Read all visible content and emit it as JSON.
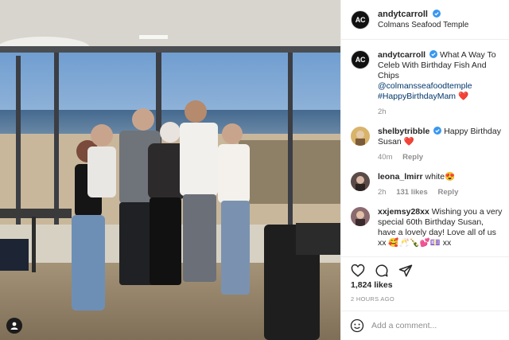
{
  "post": {
    "username": "andytcarroll",
    "location": "Colmans Seafood Temple",
    "avatar_text": "AC",
    "verified": true
  },
  "caption": {
    "username": "andytcarroll",
    "text": "What A Way To Celeb With Birthday Fish And Chips",
    "mention": "@colmansseafoodtemple",
    "hashtag": "#HappyBirthdayMam",
    "emoji": "❤️",
    "time": "2h"
  },
  "comments": [
    {
      "username": "shelbytribble",
      "verified": true,
      "text": "Happy Birthday Susan",
      "emoji": "❤️",
      "time": "40m",
      "likes": "",
      "reply": "Reply"
    },
    {
      "username": "leona_lmirr",
      "verified": false,
      "text": "white",
      "emoji": "😍",
      "time": "2h",
      "likes": "131 likes",
      "reply": "Reply"
    },
    {
      "username": "xxjemsy28xx",
      "verified": false,
      "text": "Wishing you a very special 60th Birthday Susan, have a lovely day! Love all of us xx",
      "emoji": "🥰🥂🍾💕💷 xx",
      "time": "",
      "likes": "",
      "reply": ""
    }
  ],
  "actions": {
    "likes": "1,824 likes",
    "posted": "2 HOURS AGO"
  },
  "composer": {
    "placeholder": "Add a comment..."
  },
  "icons": [
    "verified-badge-icon",
    "heart-icon",
    "comment-icon",
    "share-icon",
    "emoji-icon",
    "user-tag-icon"
  ],
  "colors": {
    "verified": "#3897f0",
    "link": "#00376b",
    "muted": "#8e8e8e",
    "heart": "#ed4956"
  }
}
